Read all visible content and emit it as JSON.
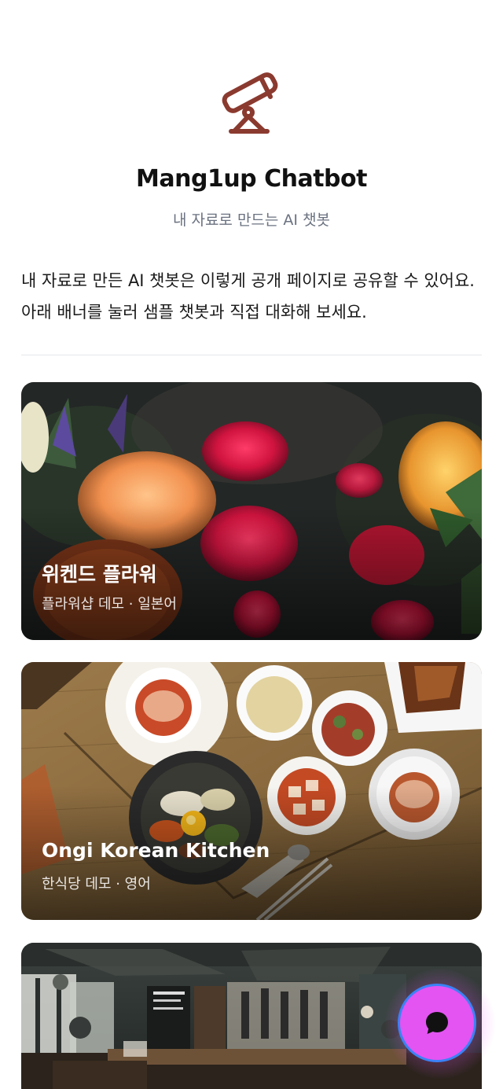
{
  "header": {
    "title": "Mang1up Chatbot",
    "subtitle": "내 자료로 만드는 AI 챗봇",
    "logo_icon": "telescope-icon",
    "logo_color": "#8b3a2f"
  },
  "intro": {
    "text": "내 자료로 만든 AI 챗봇은 이렇게 공개 페이지로 공유할 수 있어요. 아래 배너를 눌러 샘플 챗봇과 직접 대화해 보세요."
  },
  "cards": [
    {
      "title": "위켄드 플라워",
      "subtitle": "플라워샵 데모 · 일본어",
      "image": "flower-bouquet-photo"
    },
    {
      "title": "Ongi Korean Kitchen",
      "subtitle": "한식당 데모 · 영어",
      "image": "korean-food-table-photo"
    },
    {
      "title": "",
      "subtitle": "",
      "image": "cafe-interior-photo"
    }
  ],
  "chat_button": {
    "icon": "chat-bubble-icon",
    "color": "#e354f2",
    "border_color": "#3b82f6"
  }
}
